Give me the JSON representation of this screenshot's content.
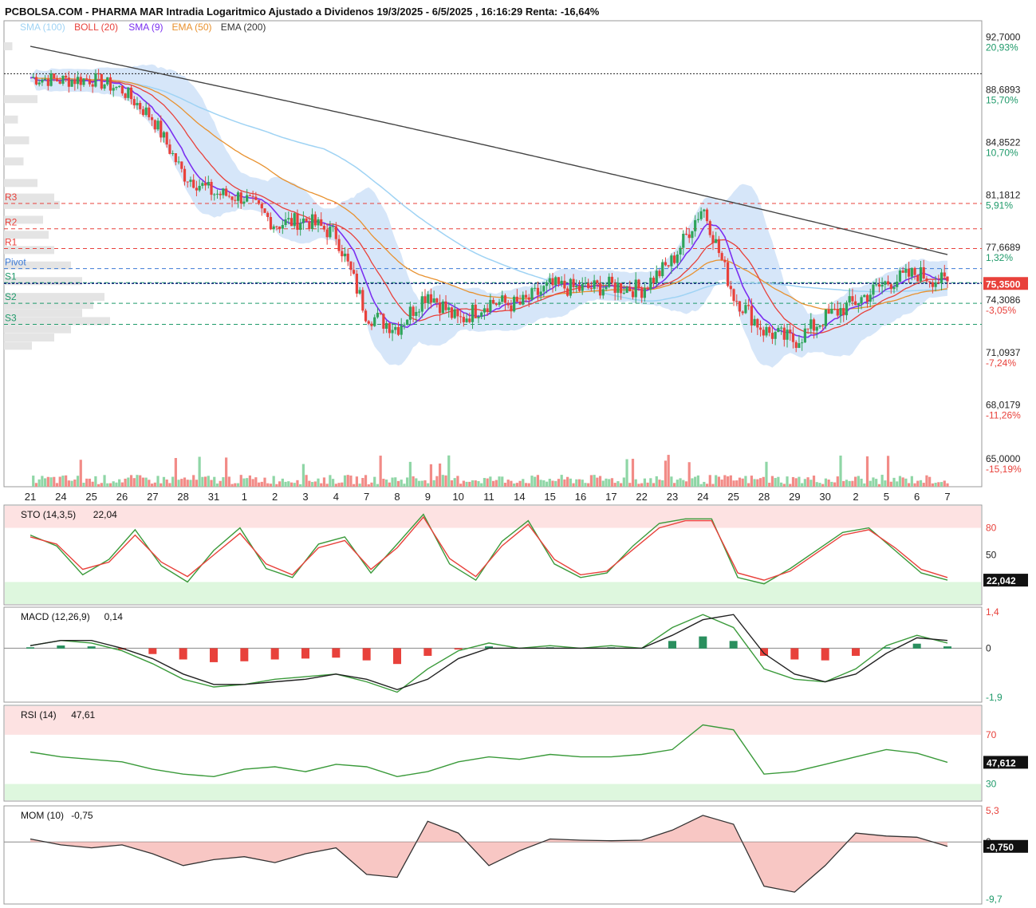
{
  "header": {
    "title": "PCBOLSA.COM - PHARMA MAR Intradia Logaritmico Ajustado a Dividenos 19/3/2025 - 6/5/2025 , 16:16:29 Renta: -16,64%"
  },
  "legend": [
    {
      "label": "SMA (100)",
      "color": "#9fd3f4"
    },
    {
      "label": "BOLL (20)",
      "color": "#e8413b"
    },
    {
      "label": "SMA (9)",
      "color": "#7b2ff0"
    },
    {
      "label": "EMA (50)",
      "color": "#e8912e"
    },
    {
      "label": "EMA (200)",
      "color": "#333333"
    }
  ],
  "colors": {
    "up": "#2ea45a",
    "down": "#e8413b",
    "boll_fill": "#cfe2f8",
    "resistance": "#e8413b",
    "pivot": "#3c7bd6",
    "support": "#1f9a6a",
    "price_tag": "#e8413b"
  },
  "chart_data": [
    {
      "type": "candlestick",
      "title": "PHARMA MAR Intradia Logaritmico Ajustado a Dividenos 19/3/2025 - 6/5/2025",
      "x_labels": [
        "21",
        "24",
        "25",
        "26",
        "27",
        "28",
        "31",
        "1",
        "2",
        "3",
        "4",
        "7",
        "8",
        "9",
        "10",
        "11",
        "14",
        "15",
        "16",
        "17",
        "22",
        "23",
        "24",
        "25",
        "28",
        "29",
        "30",
        "2",
        "5",
        "6",
        "7"
      ],
      "y_scale": "log",
      "ylim": [
        63.5,
        94.0
      ],
      "y_ticks": [
        {
          "value": 92.7,
          "label": "92,7000",
          "pct": "20,93%"
        },
        {
          "value": 88.6893,
          "label": "88,6893",
          "pct": "15,70%"
        },
        {
          "value": 84.8522,
          "label": "84,8522",
          "pct": "10,70%"
        },
        {
          "value": 81.1812,
          "label": "81,1812",
          "pct": "5,91%"
        },
        {
          "value": 77.6689,
          "label": "77,6689",
          "pct": "1,32%"
        },
        {
          "value": 74.3086,
          "label": "74,3086",
          "pct": "-3,05%"
        },
        {
          "value": 71.0937,
          "label": "71,0937",
          "pct": "-7,24%"
        },
        {
          "value": 68.0179,
          "label": "68,0179",
          "pct": "-11,26%"
        },
        {
          "value": 65.0,
          "label": "65,0000",
          "pct": "-15,19%"
        }
      ],
      "last_price": {
        "value": 75.35,
        "label": "75,3500"
      },
      "reference_price": 89.9,
      "pivots": [
        {
          "name": "R3",
          "value": 80.6
        },
        {
          "name": "R2",
          "value": 78.9
        },
        {
          "name": "R1",
          "value": 77.6
        },
        {
          "name": "Pivot",
          "value": 76.3
        },
        {
          "name": "S1",
          "value": 75.4
        },
        {
          "name": "S2",
          "value": 74.1
        },
        {
          "name": "S3",
          "value": 72.8
        }
      ],
      "close_series": [
        {
          "x": "21",
          "y": 89.6
        },
        {
          "x": "24",
          "y": 89.4
        },
        {
          "x": "25",
          "y": 89.5
        },
        {
          "x": "26",
          "y": 88.7
        },
        {
          "x": "27",
          "y": 86.6
        },
        {
          "x": "28",
          "y": 82.6
        },
        {
          "x": "31",
          "y": 81.3
        },
        {
          "x": "1",
          "y": 81.0
        },
        {
          "x": "2",
          "y": 79.2
        },
        {
          "x": "3",
          "y": 79.5
        },
        {
          "x": "4",
          "y": 78.5
        },
        {
          "x": "7",
          "y": 73.4
        },
        {
          "x": "8",
          "y": 72.6
        },
        {
          "x": "9",
          "y": 74.8
        },
        {
          "x": "10",
          "y": 73.0
        },
        {
          "x": "11",
          "y": 74.2
        },
        {
          "x": "14",
          "y": 74.0
        },
        {
          "x": "15",
          "y": 75.2
        },
        {
          "x": "16",
          "y": 75.0
        },
        {
          "x": "17",
          "y": 75.2
        },
        {
          "x": "22",
          "y": 75.0
        },
        {
          "x": "23",
          "y": 76.8
        },
        {
          "x": "24",
          "y": 80.4
        },
        {
          "x": "25",
          "y": 74.6
        },
        {
          "x": "28",
          "y": 72.4
        },
        {
          "x": "29",
          "y": 71.8
        },
        {
          "x": "30",
          "y": 73.2
        },
        {
          "x": "2",
          "y": 74.2
        },
        {
          "x": "5",
          "y": 75.4
        },
        {
          "x": "6",
          "y": 76.0
        },
        {
          "x": "7",
          "y": 75.35
        }
      ]
    },
    {
      "type": "line",
      "title": "STO (14,3,5)",
      "value_label": "22,04",
      "ylim": [
        0,
        100
      ],
      "levels": [
        {
          "value": 80,
          "label": "80"
        },
        {
          "value": 50,
          "label": "50"
        }
      ],
      "last": {
        "value": 22.042,
        "label": "22,042"
      },
      "zones": {
        "overbought": 80,
        "oversold": 20
      },
      "series": [
        {
          "values": [
            72,
            60,
            28,
            45,
            78,
            38,
            20,
            55,
            80,
            35,
            25,
            62,
            70,
            30,
            62,
            95,
            40,
            22,
            65,
            88,
            40,
            25,
            30,
            60,
            85,
            90,
            90,
            25,
            18,
            35,
            55,
            75,
            80,
            55,
            30,
            22
          ]
        },
        {
          "values": [
            70,
            62,
            34,
            42,
            72,
            42,
            26,
            50,
            74,
            40,
            28,
            58,
            66,
            34,
            58,
            92,
            46,
            26,
            60,
            84,
            45,
            28,
            32,
            56,
            80,
            88,
            88,
            30,
            22,
            32,
            52,
            72,
            78,
            58,
            34,
            25
          ]
        }
      ]
    },
    {
      "type": "line",
      "title": "MACD (12,26,9)",
      "value_label": "0,14",
      "ylim": [
        -1.9,
        1.4
      ],
      "levels": [
        {
          "value": 1.4,
          "label": "1,4"
        },
        {
          "value": 0,
          "label": "0"
        },
        {
          "value": -1.9,
          "label": "-1,9"
        }
      ],
      "series": [
        {
          "values": [
            0.1,
            0.3,
            0.2,
            -0.1,
            -0.6,
            -1.2,
            -1.5,
            -1.4,
            -1.2,
            -1.1,
            -1.0,
            -1.3,
            -1.7,
            -0.8,
            -0.1,
            0.2,
            0.0,
            0.1,
            0.0,
            0.1,
            0.0,
            0.8,
            1.3,
            0.8,
            -0.8,
            -1.2,
            -1.3,
            -0.8,
            0.1,
            0.5,
            0.2
          ]
        },
        {
          "values": [
            0.1,
            0.3,
            0.3,
            0.0,
            -0.4,
            -1.0,
            -1.4,
            -1.4,
            -1.3,
            -1.2,
            -1.0,
            -1.2,
            -1.6,
            -1.2,
            -0.4,
            0.0,
            0.0,
            0.0,
            0.0,
            0.0,
            0.0,
            0.5,
            1.1,
            1.3,
            -0.2,
            -1.0,
            -1.3,
            -1.0,
            -0.2,
            0.4,
            0.3
          ]
        }
      ]
    },
    {
      "type": "line",
      "title": "RSI (14)",
      "value_label": "47,61",
      "ylim": [
        20,
        90
      ],
      "levels": [
        {
          "value": 70,
          "label": "70"
        },
        {
          "value": 30,
          "label": "30"
        }
      ],
      "last": {
        "value": 47.612,
        "label": "47,612"
      },
      "series": [
        {
          "values": [
            56,
            52,
            50,
            48,
            42,
            38,
            36,
            42,
            44,
            40,
            46,
            44,
            36,
            40,
            48,
            52,
            50,
            54,
            52,
            52,
            54,
            58,
            78,
            74,
            38,
            40,
            46,
            52,
            58,
            55,
            47.6
          ]
        }
      ]
    },
    {
      "type": "area",
      "title": "MOM (10)",
      "value_label": "-0,75",
      "ylim": [
        -9.7,
        5.3
      ],
      "levels": [
        {
          "value": 5.3,
          "label": "5,3"
        },
        {
          "value": 0,
          "label": "0"
        },
        {
          "value": -9.7,
          "label": "-9,7"
        }
      ],
      "last": {
        "value": -0.75,
        "label": "-0,750"
      },
      "series": [
        {
          "values": [
            0.5,
            -0.5,
            -1.0,
            -0.5,
            -2.0,
            -4.0,
            -3.0,
            -2.5,
            -3.5,
            -2.0,
            -1.0,
            -5.5,
            -6.0,
            3.5,
            1.5,
            -4.0,
            -1.5,
            0.5,
            0.3,
            0.2,
            0.3,
            2.0,
            4.5,
            3.0,
            -7.5,
            -8.5,
            -4.0,
            1.5,
            1.0,
            0.8,
            -0.75
          ]
        }
      ]
    }
  ]
}
